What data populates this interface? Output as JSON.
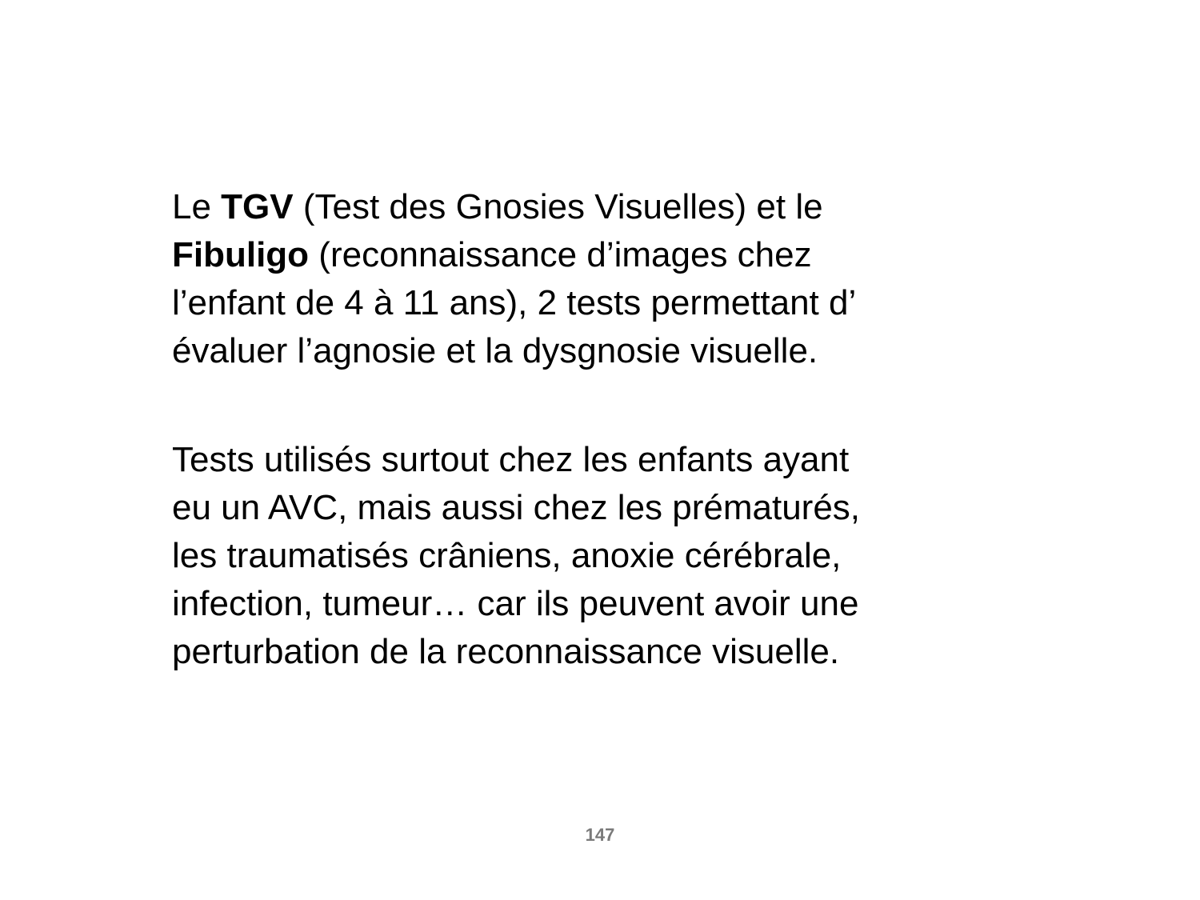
{
  "paragraph1": {
    "line1": {
      "a": "Le ",
      "b": "TGV",
      "c": "  (Test des Gnosies Visuelles) et le"
    },
    "line2": {
      "a": "Fibuligo",
      "b": " (reconnaissance d’images chez"
    },
    "line3": "l’enfant de 4 à 11 ans), 2 tests permettant d’",
    "line4": "évaluer l’agnosie et la dysgnosie visuelle."
  },
  "paragraph2": {
    "lines": [
      "Tests utilisés surtout chez les enfants ayant",
      "eu un AVC, mais aussi chez les prématurés,",
      "les traumatisés crâniens, anoxie cérébrale,",
      "infection, tumeur… car ils peuvent avoir une",
      "perturbation de la reconnaissance visuelle."
    ]
  },
  "page_number": "147",
  "colors": {
    "text": "#000000",
    "page_number": "#7a7a7a",
    "background": "#ffffff"
  }
}
